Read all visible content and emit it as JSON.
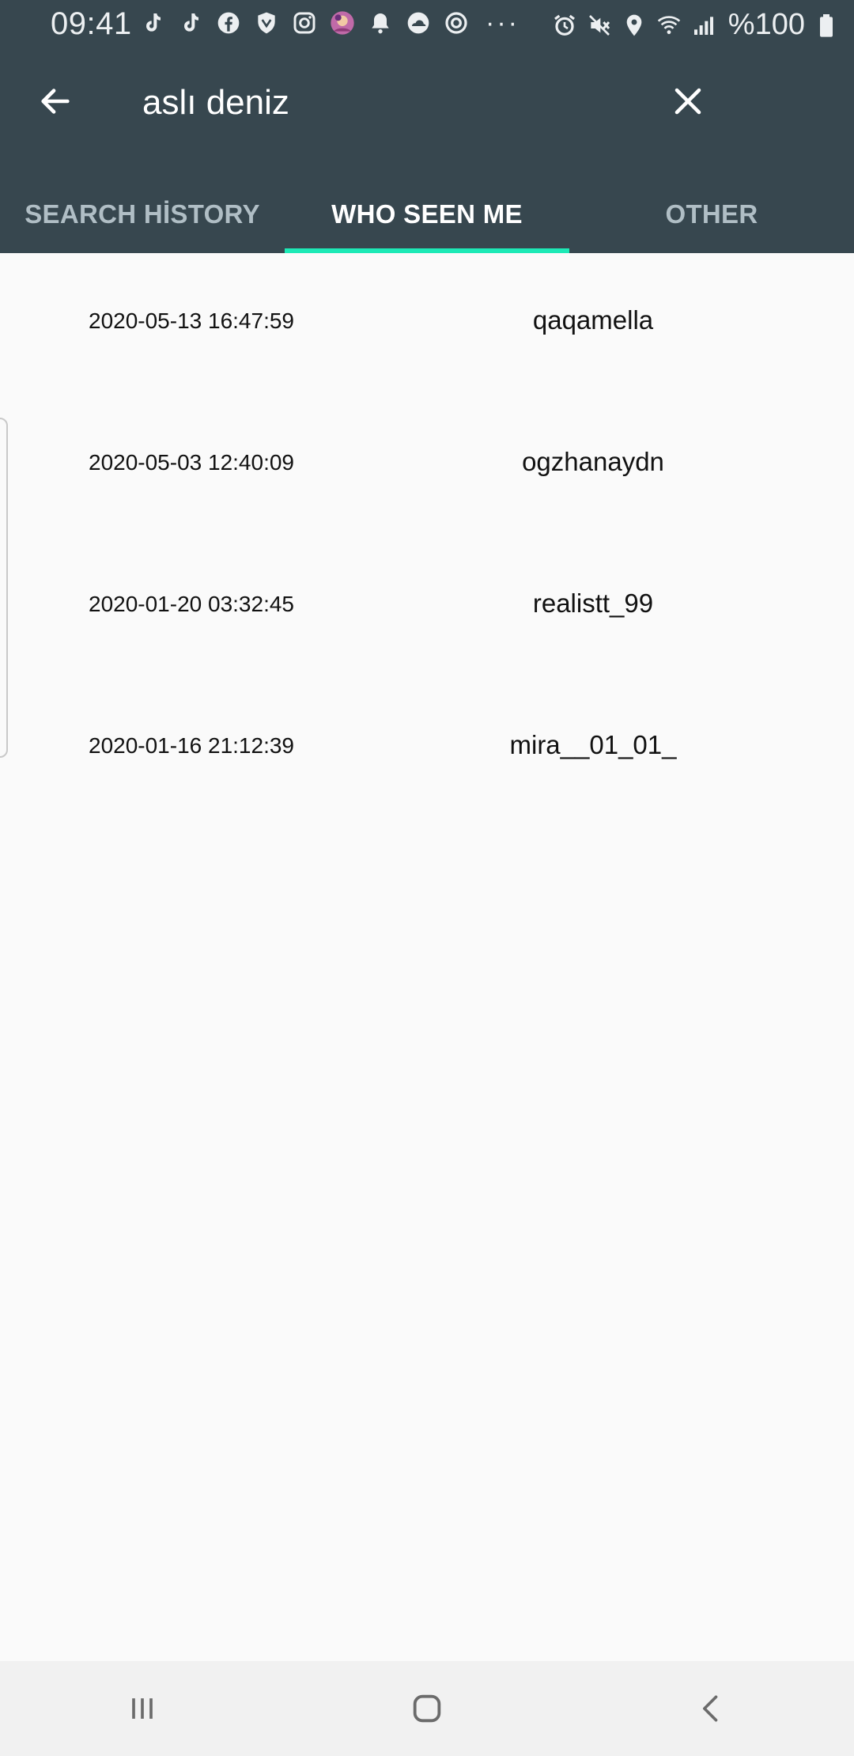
{
  "status_bar": {
    "time": "09:41",
    "battery": "%100",
    "left_icons": [
      "tiktok-icon",
      "tiktok-icon",
      "facebook-icon",
      "shield-icon",
      "instagram-icon",
      "avatar-icon",
      "bell-icon",
      "cloud-icon",
      "sync-icon"
    ],
    "more": "···",
    "right_icons": [
      "alarm-icon",
      "mute-icon",
      "location-icon",
      "wifi-icon",
      "signal-icon",
      "battery-icon"
    ]
  },
  "search": {
    "query": "aslı deniz"
  },
  "tabs": [
    {
      "label": "SEARCH HİSTORY",
      "active": false
    },
    {
      "label": "WHO SEEN ME",
      "active": true
    },
    {
      "label": "OTHER",
      "active": false
    }
  ],
  "entries": [
    {
      "date": "2020-05-13 16:47:59",
      "username": "qaqamella"
    },
    {
      "date": "2020-05-03 12:40:09",
      "username": "ogzhanaydn"
    },
    {
      "date": "2020-01-20 03:32:45",
      "username": "realistt_99"
    },
    {
      "date": "2020-01-16 21:12:39",
      "username": "mira__01_01_"
    }
  ],
  "colors": {
    "appbar": "#37474f",
    "accent": "#1de9b6",
    "background": "#fafafa"
  }
}
